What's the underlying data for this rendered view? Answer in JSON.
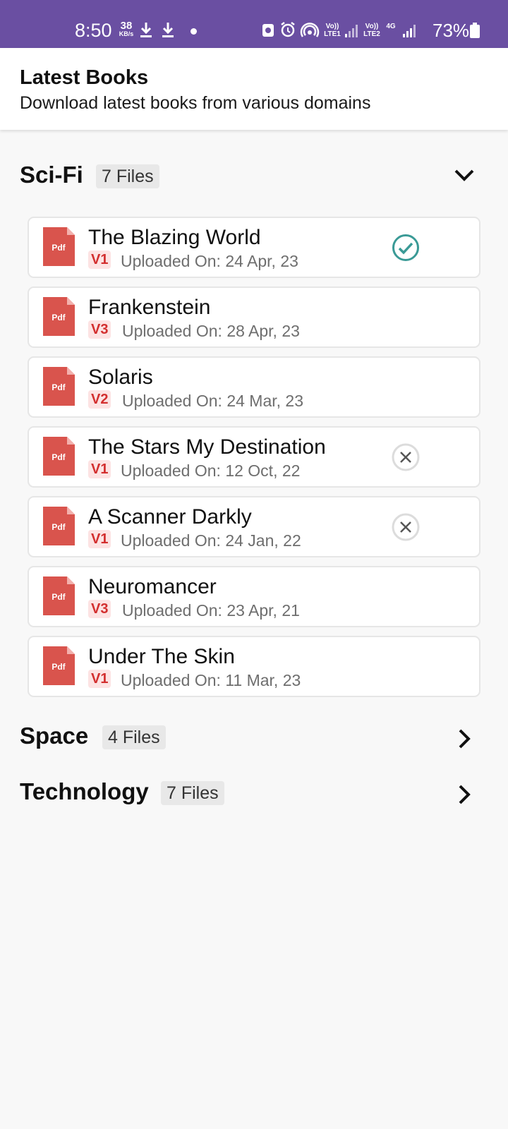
{
  "status_bar": {
    "time": "8:50",
    "net_speed": "38",
    "net_speed_unit": "KB/s",
    "sim1_label": "Vo)) LTE1",
    "sim2_label": "Vo)) LTE2",
    "network_type": "4G",
    "battery": "73%",
    "icons": [
      "download-icon",
      "download-icon",
      "notification-dot",
      "app-icon",
      "alarm-icon",
      "hotspot-icon",
      "signal-icon",
      "signal-icon",
      "battery-icon"
    ]
  },
  "header": {
    "title": "Latest Books",
    "subtitle": "Download latest books from various domains"
  },
  "categories": [
    {
      "name": "Sci-Fi",
      "count": "7 Files",
      "expanded": true,
      "books": [
        {
          "title": "The Blazing World",
          "version": "V1",
          "uploaded": "Uploaded On: 24 Apr, 23",
          "status": "downloaded"
        },
        {
          "title": "Frankenstein",
          "version": "V3",
          "uploaded": "Uploaded On: 28 Apr, 23",
          "status": "none"
        },
        {
          "title": "Solaris",
          "version": "V2",
          "uploaded": "Uploaded On: 24 Mar, 23",
          "status": "none"
        },
        {
          "title": "The Stars My Destination",
          "version": "V1",
          "uploaded": "Uploaded On: 12 Oct, 22",
          "status": "cancel"
        },
        {
          "title": "A Scanner Darkly",
          "version": "V1",
          "uploaded": "Uploaded On: 24 Jan, 22",
          "status": "cancel"
        },
        {
          "title": "Neuromancer",
          "version": "V3",
          "uploaded": "Uploaded On: 23 Apr, 21",
          "status": "none"
        },
        {
          "title": "Under The Skin",
          "version": "V1",
          "uploaded": "Uploaded On: 11 Mar, 23",
          "status": "none"
        }
      ]
    },
    {
      "name": "Space",
      "count": "4 Files",
      "expanded": false
    },
    {
      "name": "Technology",
      "count": "7 Files",
      "expanded": false
    }
  ],
  "pdf_label": "Pdf",
  "colors": {
    "status_bar": "#6a4fa2",
    "pdf_icon": "#d9544d",
    "version_text": "#d32f2f",
    "version_bg": "#fde3e3",
    "check": "#3a9a96",
    "cancel": "#555555"
  }
}
